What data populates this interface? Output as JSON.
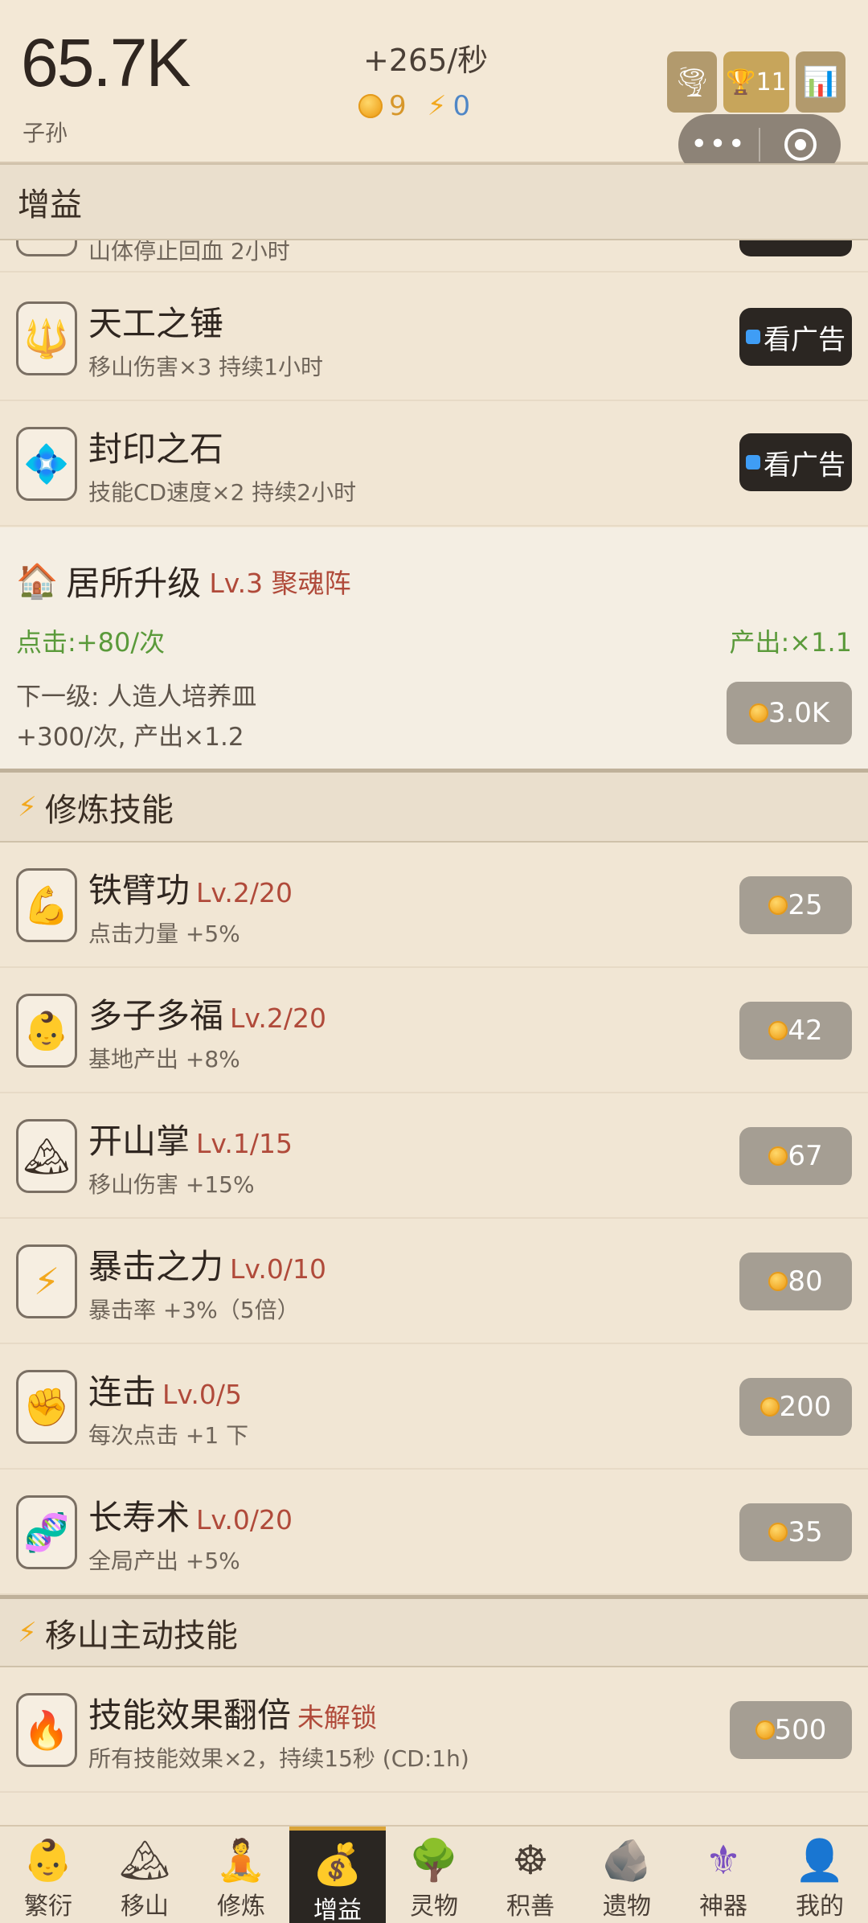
{
  "header": {
    "count": "65.7K",
    "count_label": "子孙",
    "rate": "+265/秒",
    "coins": "9",
    "energy": "0",
    "top_buttons": {
      "tornado_icon": "tornado-icon",
      "trophy_count": "11",
      "stats_icon": "chart-icon"
    }
  },
  "buff_section": {
    "title": "增益",
    "partial_text": "山体停止回血 2小时",
    "items": [
      {
        "name": "天工之锤",
        "desc": "移山伤害×3 持续1小时",
        "button": "看广告",
        "icon": "hammer-icon"
      },
      {
        "name": "封印之石",
        "desc": "技能CD速度×2 持续2小时",
        "button": "看广告",
        "icon": "diamond-icon"
      }
    ]
  },
  "upgrade": {
    "title": "居所升级",
    "level": "Lv.3 聚魂阵",
    "click": "点击:+80/次",
    "output": "产出:×1.1",
    "next_line1": "下一级: 人造人培养皿",
    "next_line2": "+300/次, 产出×1.2",
    "cost": "3.0K"
  },
  "skills_section": {
    "title": "修炼技能",
    "items": [
      {
        "name": "铁臂功",
        "level": "Lv.2/20",
        "desc": "点击力量 +5%",
        "cost": "25",
        "icon": "muscle-icon"
      },
      {
        "name": "多子多福",
        "level": "Lv.2/20",
        "desc": "基地产出 +8%",
        "cost": "42",
        "icon": "baby-icon"
      },
      {
        "name": "开山掌",
        "level": "Lv.1/15",
        "desc": "移山伤害 +15%",
        "cost": "67",
        "icon": "mountain-icon"
      },
      {
        "name": "暴击之力",
        "level": "Lv.0/10",
        "desc": "暴击率 +3%（5倍）",
        "cost": "80",
        "icon": "lightning-icon"
      },
      {
        "name": "连击",
        "level": "Lv.0/5",
        "desc": "每次点击 +1 下",
        "cost": "200",
        "icon": "fist-icon"
      },
      {
        "name": "长寿术",
        "level": "Lv.0/20",
        "desc": "全局产出 +5%",
        "cost": "35",
        "icon": "dna-icon"
      }
    ]
  },
  "active_section": {
    "title": "移山主动技能",
    "items": [
      {
        "name": "技能效果翻倍",
        "level": "未解锁",
        "desc": "所有技能效果×2，持续15秒 (CD:1h)",
        "cost": "500",
        "icon": "fire-icon"
      }
    ]
  },
  "tabs": [
    {
      "label": "繁衍",
      "icon": "baby-icon"
    },
    {
      "label": "移山",
      "icon": "mountain-icon"
    },
    {
      "label": "修炼",
      "icon": "meditate-icon"
    },
    {
      "label": "增益",
      "icon": "moneybag-icon"
    },
    {
      "label": "灵物",
      "icon": "tree-icon"
    },
    {
      "label": "积善",
      "icon": "wheel-icon"
    },
    {
      "label": "遗物",
      "icon": "rock-icon"
    },
    {
      "label": "神器",
      "icon": "fleur-icon"
    },
    {
      "label": "我的",
      "icon": "person-icon"
    }
  ],
  "active_tab": "增益"
}
